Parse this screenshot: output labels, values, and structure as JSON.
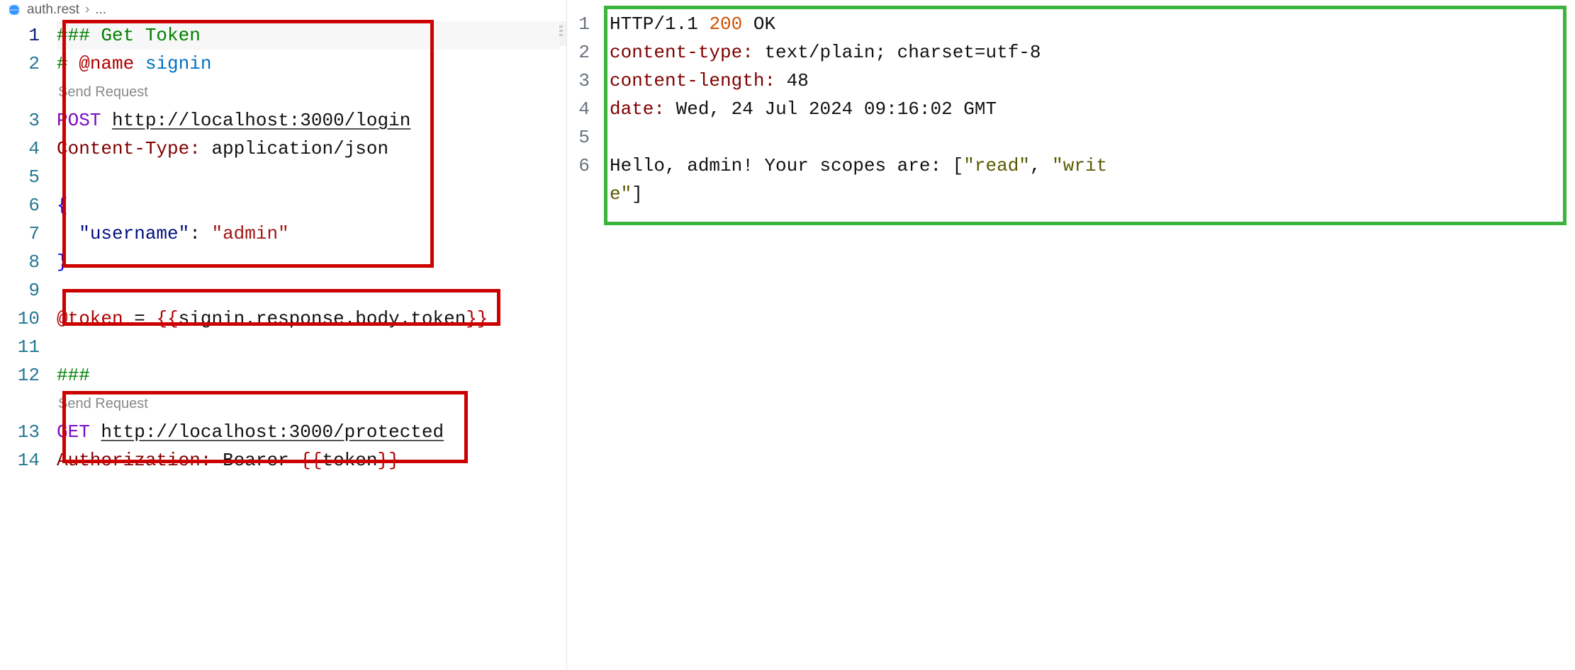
{
  "breadcrumb": {
    "filename": "auth.rest",
    "separator": "›",
    "tail": "..."
  },
  "codelens": {
    "send_request": "Send Request"
  },
  "left": {
    "lines": [
      "1",
      "2",
      "3",
      "4",
      "5",
      "6",
      "7",
      "8",
      "9",
      "10",
      "11",
      "12",
      "13",
      "14"
    ],
    "t": {
      "sec1": "### Get Token",
      "comment_hash": "# ",
      "at_name": "@name",
      "signin": " signin",
      "post": "POST",
      "login_url": "http://localhost:3000/login",
      "ct_header": "Content-Type",
      "ct_value": "application/json",
      "brace_open": "{",
      "u_key": "\"username\"",
      "u_val": "\"admin\"",
      "brace_close": "}",
      "at_token": "@token",
      "eq": " = ",
      "token_expr_open": "{{",
      "token_expr_body": "signin.response.body.token",
      "token_expr_close": "}}",
      "sec2": "###",
      "get": "GET",
      "protected_url": "http://localhost:3000/protected",
      "auth_header": "Authorization",
      "bearer": "Bearer ",
      "token_open": "{{",
      "token_var": "token",
      "token_close": "}}"
    }
  },
  "right": {
    "lines": [
      "1",
      "2",
      "3",
      "4",
      "5",
      "6"
    ],
    "t": {
      "proto": "HTTP/1.1 ",
      "status_code": "200",
      "status_text": " OK",
      "ct_h": "content-type",
      "ct_v": "text/plain; charset=utf-8",
      "cl_h": "content-length",
      "cl_v": "48",
      "date_h": "date",
      "date_v": "Wed, 24 Jul 2024 09:16:02 GMT",
      "body1": "Hello, admin! Your scopes are: [",
      "s_read": "\"read\"",
      "comma": ", ",
      "s_writ": "\"writ",
      "s_e": "e\"",
      "body_end": "]"
    }
  }
}
